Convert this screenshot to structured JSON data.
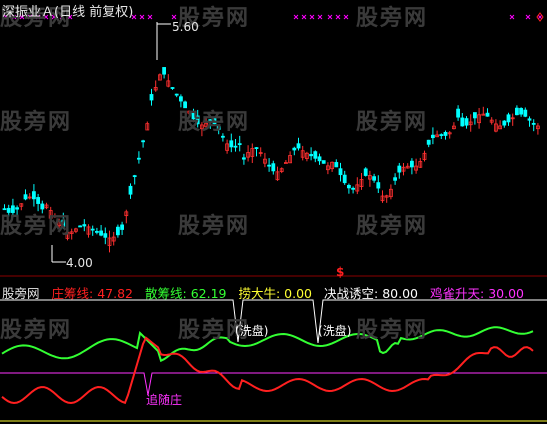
{
  "header": {
    "title": "深振业Ａ(日线 前复权)"
  },
  "watermark": {
    "text": "股旁网"
  },
  "price_panel": {
    "high_label": "5.60",
    "low_label": "4.00",
    "marker_color": "#ff00ff",
    "up_color": "#ff3030",
    "down_color": "#00ffff",
    "ma_color": "#ffffff"
  },
  "indicator": {
    "name": "股旁网",
    "items": [
      {
        "label": "庄筹线",
        "value": "47.82",
        "color": "#ff2020"
      },
      {
        "label": "散筹线",
        "value": "62.19",
        "color": "#33ff33"
      },
      {
        "label": "捞大牛",
        "value": "0.00",
        "color": "#ffff33"
      },
      {
        "label": "决战诱空",
        "value": "80.00",
        "color": "#ffffff"
      },
      {
        "label": "鸡雀升天",
        "value": "30.00",
        "color": "#ff33ff"
      }
    ],
    "signal_symbol": "$",
    "annotations": {
      "washout_1": "洗盘",
      "washout_2": "洗盘",
      "follow": "追随庄"
    }
  }
}
